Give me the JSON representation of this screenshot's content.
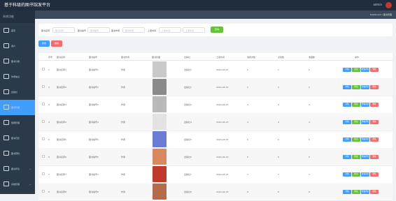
{
  "header": {
    "title": "基于科级的图书馆发平台",
    "user": "admin"
  },
  "sidebar": {
    "head": "系统功能",
    "items": [
      {
        "label": "首页"
      },
      {
        "label": "用户"
      },
      {
        "label": "图书分类"
      },
      {
        "label": "作者信息"
      },
      {
        "label": "出版社"
      },
      {
        "label": "图书管理"
      },
      {
        "label": "借阅管理"
      },
      {
        "label": "图书归还"
      },
      {
        "label": "图书预约"
      },
      {
        "label": "图书评论"
      },
      {
        "label": "系统管理"
      },
      {
        "label": "公告管理"
      },
      {
        "label": "用户管理"
      }
    ]
  },
  "breadcrumb": "Dashboard / 图书管理",
  "filters": {
    "label1": "图书名称",
    "placeholder1": "图书名称",
    "label2": "图书编号",
    "placeholder2": "图书编号",
    "label3": "图书作者",
    "placeholder3": "图书作者",
    "label4": "上架时间",
    "placeholder4": "上架时间",
    "placeholder5": "上架时间",
    "query": "查询"
  },
  "actions": {
    "add": "新增",
    "delete": "删除"
  },
  "table": {
    "headers": [
      "序号",
      "图书名称",
      "图书编号",
      "图书作者",
      "图书封面",
      "出版社",
      "上架时间",
      "借阅次数",
      "点赞数",
      "收藏数",
      "操作"
    ],
    "rows": [
      {
        "no": "1",
        "name": "图书名称1",
        "code": "图书编号1",
        "author": "作者",
        "publisher": "出版社1",
        "time": "2024-04-23",
        "borrow": "1",
        "like": "1",
        "fav": "1",
        "cover": "#c9c9c9"
      },
      {
        "no": "2",
        "name": "图书名称2",
        "code": "图书编号2",
        "author": "作者",
        "publisher": "出版社2",
        "time": "2024-04-23",
        "borrow": "2",
        "like": "2",
        "fav": "2",
        "cover": "#8a8a8a"
      },
      {
        "no": "3",
        "name": "图书名称3",
        "code": "图书编号3",
        "author": "作者",
        "publisher": "出版社3",
        "time": "2024-04-23",
        "borrow": "3",
        "like": "3",
        "fav": "3",
        "cover": "#b9b9b9"
      },
      {
        "no": "4",
        "name": "图书名称4",
        "code": "图书编号4",
        "author": "作者",
        "publisher": "出版社4",
        "time": "2024-04-23",
        "borrow": "4",
        "like": "4",
        "fav": "4",
        "cover": "#e3e3e3"
      },
      {
        "no": "5",
        "name": "图书名称5",
        "code": "图书编号5",
        "author": "作者",
        "publisher": "出版社5",
        "time": "2024-04-23",
        "borrow": "5",
        "like": "5",
        "fav": "5",
        "cover": "#6b7bd6"
      },
      {
        "no": "6",
        "name": "图书名称6",
        "code": "图书编号6",
        "author": "作者",
        "publisher": "出版社6",
        "time": "2024-04-23",
        "borrow": "6",
        "like": "6",
        "fav": "6",
        "cover": "#d98860"
      },
      {
        "no": "7",
        "name": "图书名称7",
        "code": "图书编号7",
        "author": "作者",
        "publisher": "出版社7",
        "time": "2024-04-23",
        "borrow": "7",
        "like": "7",
        "fav": "7",
        "cover": "#c0392b"
      },
      {
        "no": "8",
        "name": "图书名称8",
        "code": "图书编号8",
        "author": "作者",
        "publisher": "出版社8",
        "time": "2024-04-23",
        "borrow": "8",
        "like": "8",
        "fav": "8",
        "cover": "#b36b4a"
      }
    ],
    "ops": [
      {
        "label": "详情",
        "color": "#409eff"
      },
      {
        "label": "修改",
        "color": "#67c23a"
      },
      {
        "label": "查看评论",
        "color": "#409eff"
      },
      {
        "label": "删除",
        "color": "#f56c6c"
      }
    ]
  }
}
